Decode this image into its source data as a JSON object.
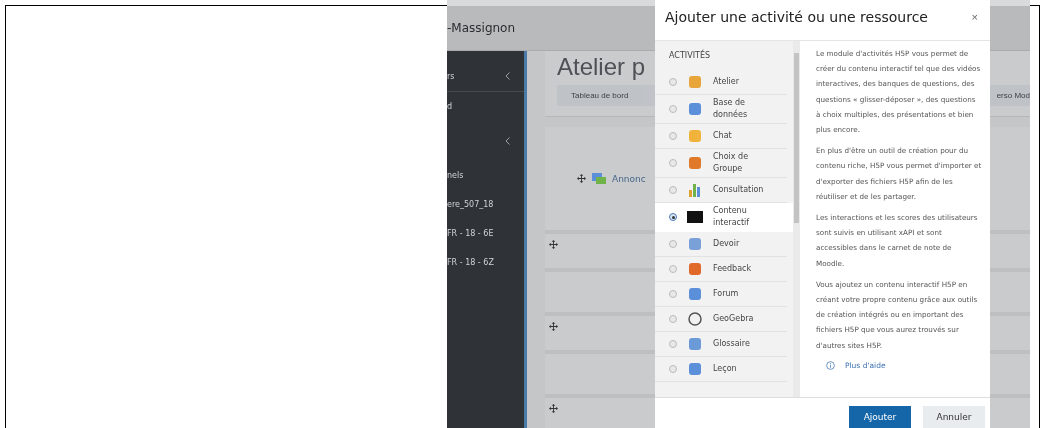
{
  "page_header": {
    "title": "-Massignon"
  },
  "sidebar": {
    "items": [
      {
        "kind": "heading",
        "label": "rs"
      },
      {
        "kind": "link",
        "label": "d"
      },
      {
        "kind": "heading"
      },
      {
        "kind": "link",
        "label": "nels"
      },
      {
        "kind": "link",
        "label": "ere_507_18"
      },
      {
        "kind": "link",
        "label": "FR - 18 - 6E"
      },
      {
        "kind": "link",
        "label": "FR - 18 - 6Z"
      }
    ]
  },
  "course": {
    "title": "Atelier p",
    "breadcrumbs": [
      "Tableau de bord",
      "erso Mod"
    ],
    "sections": [
      {
        "kind": "activity",
        "label": "Annonc"
      },
      {
        "kind": "handle"
      },
      {
        "kind": "blank"
      },
      {
        "kind": "handle"
      },
      {
        "kind": "blank"
      },
      {
        "kind": "handle"
      }
    ]
  },
  "dialog": {
    "title": "Ajouter une activité ou une ressource",
    "close": "×",
    "list_heading": "ACTIVITÉS",
    "items": [
      {
        "label": "Atelier",
        "selected": false
      },
      {
        "label": "Base de données",
        "selected": false
      },
      {
        "label": "Chat",
        "selected": false
      },
      {
        "label": "Choix de Groupe",
        "selected": false
      },
      {
        "label": "Consultation",
        "selected": false
      },
      {
        "label": "Contenu interactif",
        "selected": true
      },
      {
        "label": "Devoir",
        "selected": false
      },
      {
        "label": "Feedback",
        "selected": false
      },
      {
        "label": "Forum",
        "selected": false
      },
      {
        "label": "GeoGebra",
        "selected": false
      },
      {
        "label": "Glossaire",
        "selected": false
      },
      {
        "label": "Leçon",
        "selected": false
      }
    ],
    "description": [
      "Le module d'activités H5P vous permet de créer du contenu interactif tel que des vidéos interactives, des banques de questions, des questions « glisser-déposer », des questions à choix multiples, des présentations et bien plus encore.",
      "En plus d'être un outil de création pour du contenu riche, H5P vous permet d'importer et d'exporter des fichiers H5P afin de les réutiliser et de les partager.",
      "Les interactions et les scores des utilisateurs sont suivis en utilisant xAPI et sont accessibles dans le carnet de note de Moodle.",
      "Vous ajoutez un contenu interactif H5P en créant votre propre contenu grâce aux outils de création intégrés ou en important des fichiers H5P que vous aurez trouvés sur d'autres sites H5P."
    ],
    "help_link": "Plus d'aide",
    "buttons": [
      {
        "label": "Ajouter",
        "kind": "primary"
      },
      {
        "label": "Annuler",
        "kind": "secondary"
      }
    ]
  }
}
